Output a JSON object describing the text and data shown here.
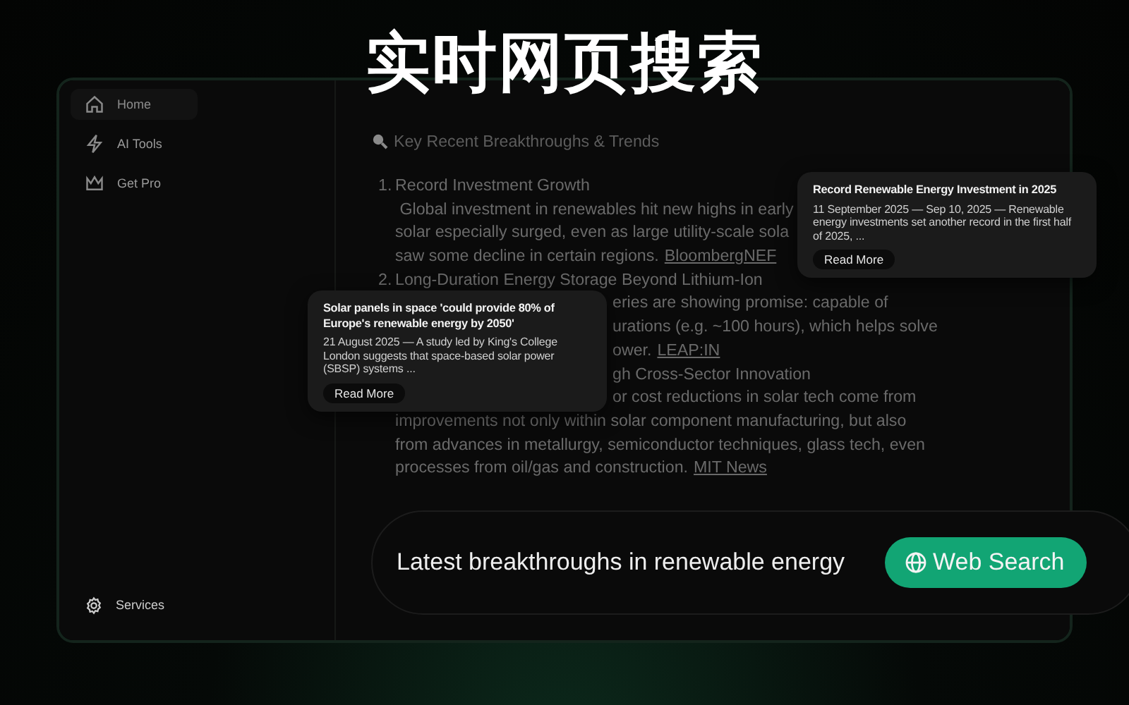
{
  "header": {
    "title": "实时网页搜索"
  },
  "sidebar": {
    "items": [
      {
        "label": "Home",
        "selected": true
      },
      {
        "label": "AI Tools",
        "selected": false
      },
      {
        "label": "Get Pro",
        "selected": false
      }
    ],
    "footer": {
      "label": "Services"
    }
  },
  "article": {
    "heading": "Key Recent Breakthroughs & Trends",
    "lines": [
      {
        "kind": "item",
        "number": "1.",
        "text": "Record Investment Growth"
      },
      {
        "kind": "body",
        "text": " Global investment in renewables hit new highs in early"
      },
      {
        "kind": "body",
        "text": "solar especially surged, even as large utility-scale sola"
      },
      {
        "kind": "body",
        "text": "saw some decline in certain regions.",
        "link": "BloombergNEF"
      },
      {
        "kind": "item",
        "number": "2.",
        "text": "Long-Duration Energy Storage Beyond Lithium-Ion"
      },
      {
        "kind": "partial",
        "text": "eries are showing promise: capable of"
      },
      {
        "kind": "partial",
        "text": "urations (e.g. ~100 hours), which helps solve"
      },
      {
        "kind": "partial",
        "text": "ower.",
        "link": "LEAP:IN"
      },
      {
        "kind": "partial",
        "text": "gh Cross-Sector Innovation"
      },
      {
        "kind": "partial",
        "text": "or cost reductions in solar tech come from"
      },
      {
        "kind": "body",
        "text": "improvements not only within solar component manufacturing, but also"
      },
      {
        "kind": "body",
        "text": "from advances in metallurgy, semiconductor techniques, glass tech, even"
      },
      {
        "kind": "body",
        "text": "processes from oil/gas and construction.",
        "link": "MIT News"
      }
    ]
  },
  "result_cards": [
    {
      "title": "Record Renewable Energy Investment in 2025",
      "text": "11 September 2025 — Sep 10, 2025 — Renewable energy investments set another record in the first half of 2025, ...",
      "button": "Read More"
    },
    {
      "title": "Solar panels in space 'could provide 80% of Europe's renewable energy by 2050'",
      "text": "21 August 2025 — A study led by King's College London suggests that space-based solar power (SBSP) systems ...",
      "button": "Read More"
    }
  ],
  "search": {
    "value": "Latest breakthroughs in renewable energy",
    "button": "Web Search"
  }
}
